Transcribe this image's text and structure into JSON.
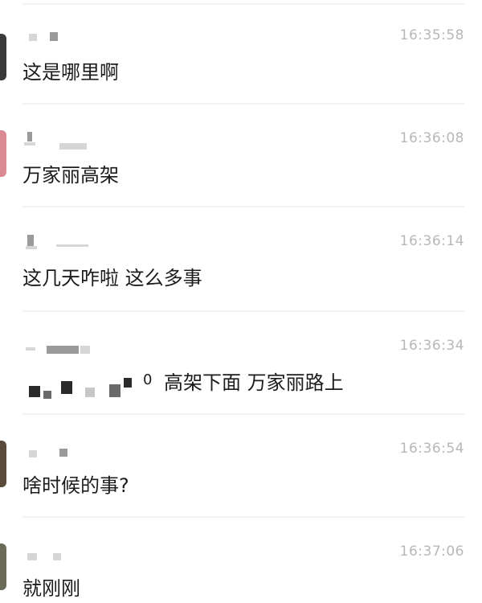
{
  "messages": [
    {
      "time": "16:35:58",
      "text": "这是哪里啊",
      "avatar_color": "#3a3a3a"
    },
    {
      "time": "16:36:08",
      "text": "万家丽高架",
      "avatar_color": "#d98a95"
    },
    {
      "time": "16:36:14",
      "text": "这几天咋啦 这么多事",
      "avatar_color": ""
    },
    {
      "time": "16:36:34",
      "text": "高架下面 万家丽路上",
      "text_prefix": "0",
      "avatar_color": ""
    },
    {
      "time": "16:36:54",
      "text": "啥时候的事?",
      "avatar_color": "#5a4a3a"
    },
    {
      "time": "16:37:06",
      "text": "就刚刚",
      "avatar_color": "#6a6a5a"
    }
  ]
}
